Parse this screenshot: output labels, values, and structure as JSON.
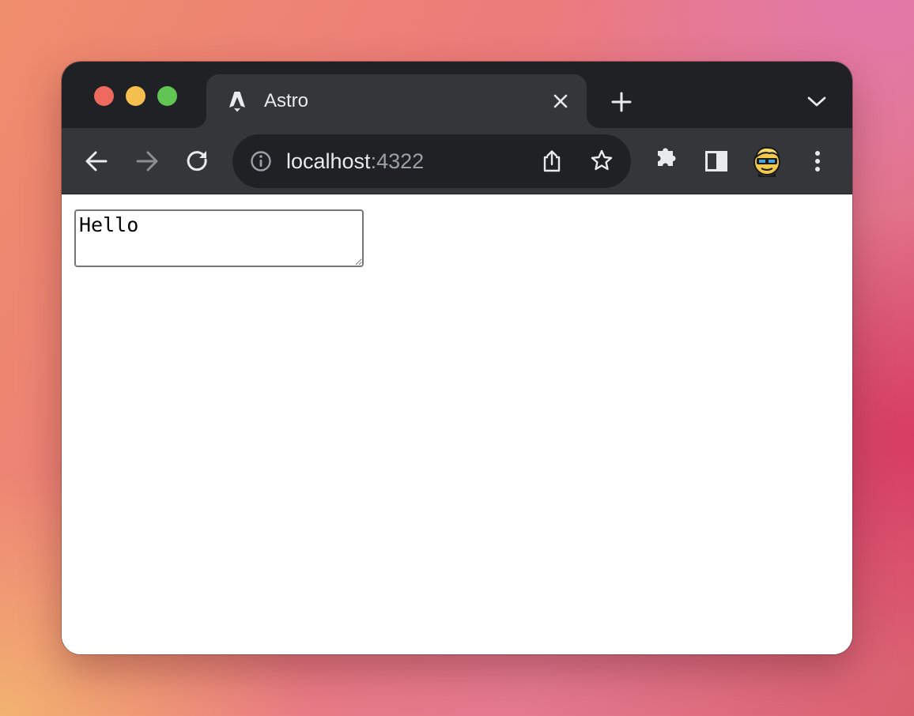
{
  "window_controls": [
    "close",
    "minimize",
    "maximize"
  ],
  "tab": {
    "title": "Astro",
    "favicon": "astro-logo-icon",
    "close_icon": "close-icon"
  },
  "toolbar": {
    "new_tab_icon": "plus-icon",
    "tab_search_icon": "chevron-down-icon",
    "back_icon": "arrow-left-icon",
    "forward_icon": "arrow-right-icon",
    "reload_icon": "reload-icon",
    "extensions_icon": "puzzle-icon",
    "side_panel_icon": "side-panel-icon",
    "profile_icon": "avatar",
    "menu_icon": "kebab-menu-icon"
  },
  "omnibox": {
    "security_icon": "info-icon",
    "host": "localhost",
    "port": ":4322",
    "share_icon": "share-icon",
    "bookmark_icon": "star-icon"
  },
  "page": {
    "textarea_value": "Hello"
  },
  "colors": {
    "tabstrip": "#202124",
    "toolbar": "#35363a",
    "omnibox": "#202124",
    "text": "#e8eaed",
    "muted": "#9aa0a6"
  }
}
